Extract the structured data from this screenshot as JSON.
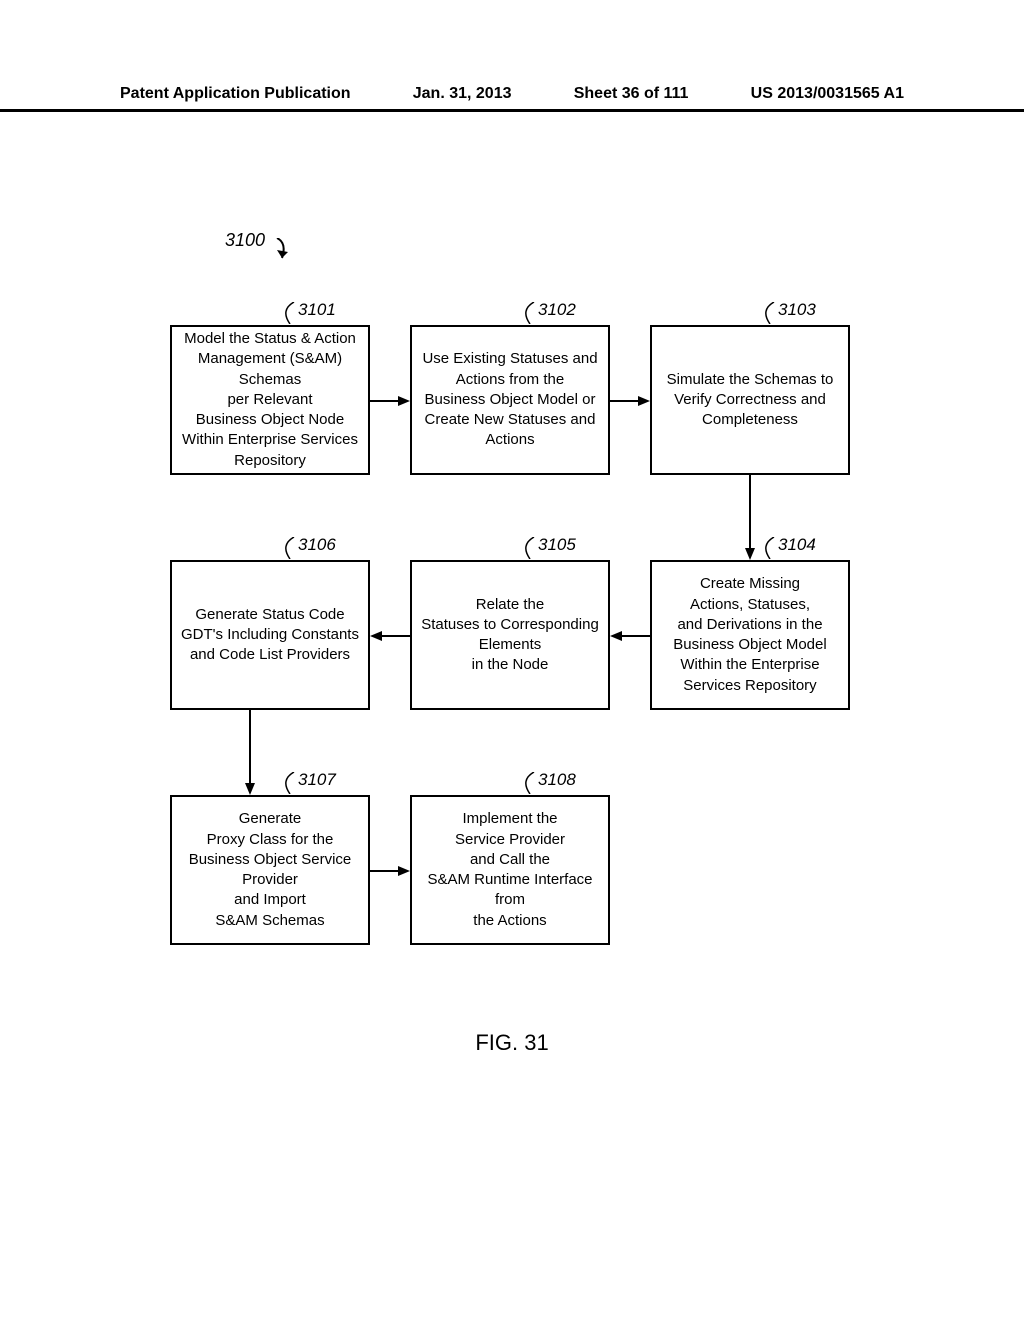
{
  "header": {
    "publication_type": "Patent Application Publication",
    "date": "Jan. 31, 2013",
    "sheet": "Sheet 36 of 111",
    "pub_number": "US 2013/0031565 A1"
  },
  "figure": {
    "main_ref": "3100",
    "caption": "FIG. 31",
    "boxes": {
      "b3101": {
        "ref": "3101",
        "text": "Model the Status & Action Management (S&AM) Schemas\nper Relevant\nBusiness Object Node Within Enterprise Services Repository"
      },
      "b3102": {
        "ref": "3102",
        "text": "Use Existing Statuses and Actions from the\nBusiness Object Model or Create New Statuses and Actions"
      },
      "b3103": {
        "ref": "3103",
        "text": "Simulate the Schemas to Verify Correctness and Completeness"
      },
      "b3104": {
        "ref": "3104",
        "text": "Create Missing\nActions, Statuses,\nand Derivations in the Business Object Model Within the Enterprise Services Repository"
      },
      "b3105": {
        "ref": "3105",
        "text": "Relate the\nStatuses to Corresponding Elements\nin the Node"
      },
      "b3106": {
        "ref": "3106",
        "text": "Generate Status Code GDT's Including Constants and Code List Providers"
      },
      "b3107": {
        "ref": "3107",
        "text": "Generate\nProxy Class for the Business Object Service Provider\nand Import\nS&AM Schemas"
      },
      "b3108": {
        "ref": "3108",
        "text": "Implement the\nService Provider\nand Call the\nS&AM Runtime Interface from\nthe Actions"
      }
    }
  }
}
